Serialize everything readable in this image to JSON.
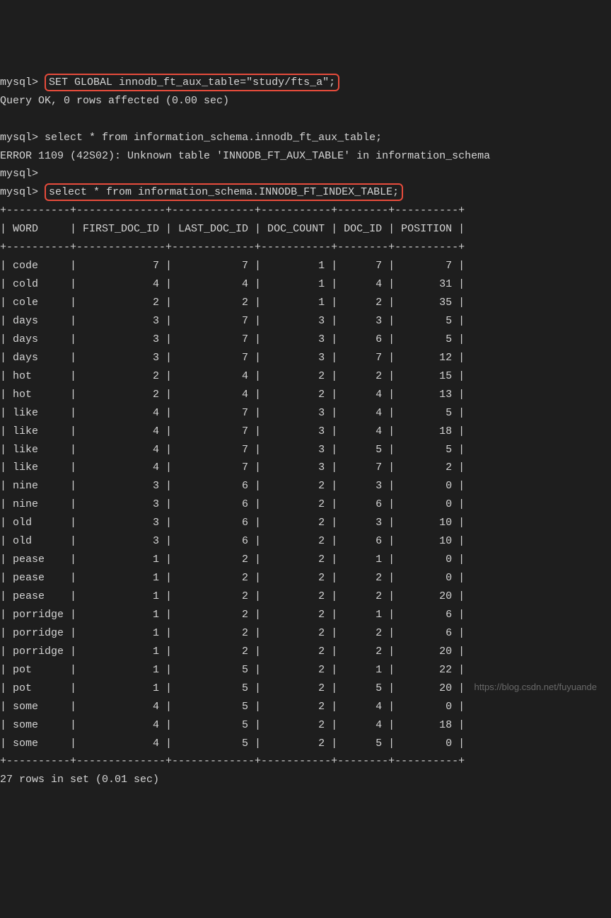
{
  "prompt": "mysql>",
  "commands": {
    "cmd1": "SET GLOBAL innodb_ft_aux_table=\"study/fts_a\";",
    "result1": "Query OK, 0 rows affected (0.00 sec)",
    "cmd2": "select * from information_schema.innodb_ft_aux_table;",
    "error2": "ERROR 1109 (42S02): Unknown table 'INNODB_FT_AUX_TABLE' in information_schema",
    "cmd3": "select * from information_schema.INNODB_FT_INDEX_TABLE;"
  },
  "chart_data": {
    "type": "table",
    "columns": [
      "WORD",
      "FIRST_DOC_ID",
      "LAST_DOC_ID",
      "DOC_COUNT",
      "DOC_ID",
      "POSITION"
    ],
    "rows": [
      [
        "code",
        7,
        7,
        1,
        7,
        7
      ],
      [
        "cold",
        4,
        4,
        1,
        4,
        31
      ],
      [
        "cole",
        2,
        2,
        1,
        2,
        35
      ],
      [
        "days",
        3,
        7,
        3,
        3,
        5
      ],
      [
        "days",
        3,
        7,
        3,
        6,
        5
      ],
      [
        "days",
        3,
        7,
        3,
        7,
        12
      ],
      [
        "hot",
        2,
        4,
        2,
        2,
        15
      ],
      [
        "hot",
        2,
        4,
        2,
        4,
        13
      ],
      [
        "like",
        4,
        7,
        3,
        4,
        5
      ],
      [
        "like",
        4,
        7,
        3,
        4,
        18
      ],
      [
        "like",
        4,
        7,
        3,
        5,
        5
      ],
      [
        "like",
        4,
        7,
        3,
        7,
        2
      ],
      [
        "nine",
        3,
        6,
        2,
        3,
        0
      ],
      [
        "nine",
        3,
        6,
        2,
        6,
        0
      ],
      [
        "old",
        3,
        6,
        2,
        3,
        10
      ],
      [
        "old",
        3,
        6,
        2,
        6,
        10
      ],
      [
        "pease",
        1,
        2,
        2,
        1,
        0
      ],
      [
        "pease",
        1,
        2,
        2,
        2,
        0
      ],
      [
        "pease",
        1,
        2,
        2,
        2,
        20
      ],
      [
        "porridge",
        1,
        2,
        2,
        1,
        6
      ],
      [
        "porridge",
        1,
        2,
        2,
        2,
        6
      ],
      [
        "porridge",
        1,
        2,
        2,
        2,
        20
      ],
      [
        "pot",
        1,
        5,
        2,
        1,
        22
      ],
      [
        "pot",
        1,
        5,
        2,
        5,
        20
      ],
      [
        "some",
        4,
        5,
        2,
        4,
        0
      ],
      [
        "some",
        4,
        5,
        2,
        4,
        18
      ],
      [
        "some",
        4,
        5,
        2,
        5,
        0
      ]
    ],
    "footer": "27 rows in set (0.01 sec)"
  },
  "watermark": "https://blog.csdn.net/fuyuande"
}
